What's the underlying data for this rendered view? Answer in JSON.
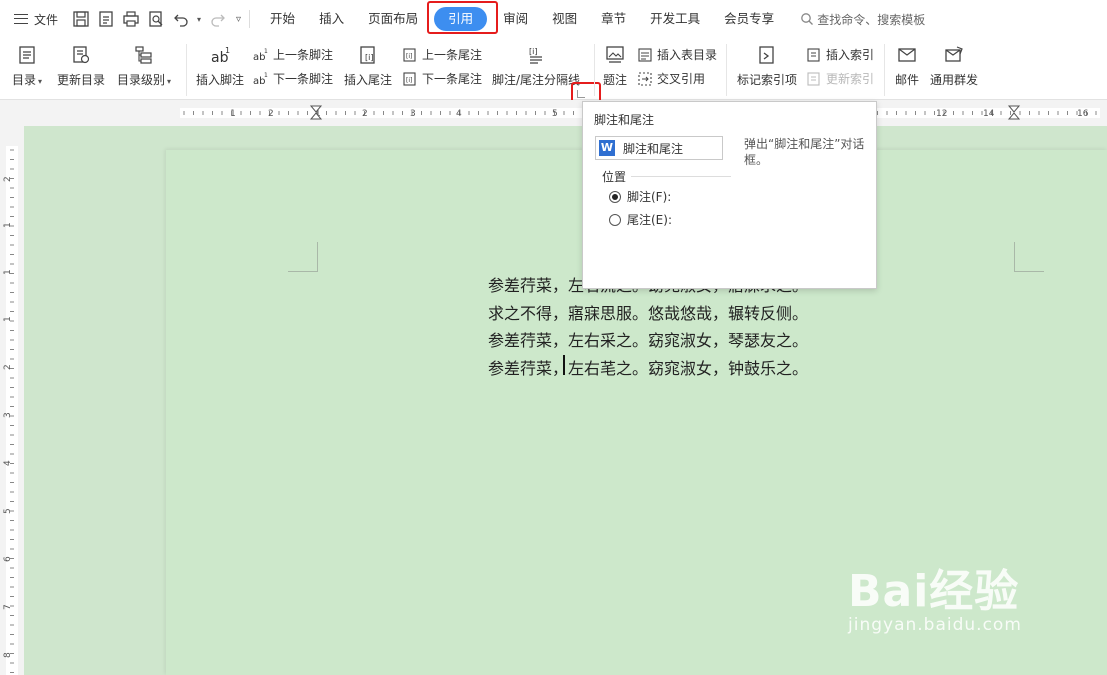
{
  "menu": {
    "file_label": "文件",
    "tabs": [
      "开始",
      "插入",
      "页面布局",
      "引用",
      "审阅",
      "视图",
      "章节",
      "开发工具",
      "会员专享"
    ],
    "active_tab": "引用",
    "search_placeholder": "查找命令、搜索模板"
  },
  "ribbon": {
    "toc": "目录",
    "update_toc": "更新目录",
    "toc_level": "目录级别",
    "insert_footnote": "插入脚注",
    "prev_footnote": "上一条脚注",
    "next_footnote": "下一条脚注",
    "insert_endnote": "插入尾注",
    "prev_endnote": "上一条尾注",
    "next_endnote": "下一条尾注",
    "separator": "脚注/尾注分隔线",
    "caption": "题注",
    "insert_table_of_figures": "插入表目录",
    "cross_reference": "交叉引用",
    "mark_index_entry": "标记索引项",
    "insert_index": "插入索引",
    "update_index": "更新索引",
    "mail": "邮件",
    "mass_send": "通用群发"
  },
  "ruler": {
    "h_numbers": [
      "1",
      "2",
      "1",
      "2",
      "3",
      "4",
      "5",
      "12",
      "14",
      "16"
    ],
    "v_numbers": [
      "2",
      "1",
      "1",
      "1",
      "2",
      "3",
      "4",
      "5",
      "6",
      "7",
      "8"
    ]
  },
  "document": {
    "lines": [
      "参差荇菜，左右流之。窈窕淑女，寤寐求之。",
      "求之不得，寤寐思服。悠哉悠哉，辗转反侧。",
      "参差荇菜，左右采之。窈窕淑女，琴瑟友之。",
      "参差荇菜，左右芼之。窈窕淑女，钟鼓乐之。"
    ]
  },
  "tooltip": {
    "title": "脚注和尾注",
    "description": "弹出“脚注和尾注”对话框。",
    "preview": {
      "dialog_title": "脚注和尾注",
      "section": "位置",
      "option_footnote": "脚注(F):",
      "option_endnote": "尾注(E):"
    }
  },
  "watermark": {
    "logo": "Bai经验",
    "url": "jingyan.baidu.com"
  },
  "colors": {
    "accent": "#3d8ef0",
    "highlight_box": "#e51c1c",
    "page_bg": "#cde8cb"
  }
}
